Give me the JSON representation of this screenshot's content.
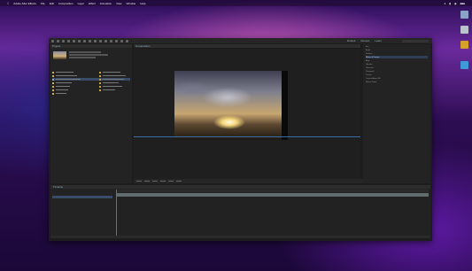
{
  "menubar": {
    "app_menu": "Adobe After Effects",
    "items": [
      "File",
      "Edit",
      "Composition",
      "Layer",
      "Effect",
      "Animation",
      "View",
      "Window",
      "Help"
    ]
  },
  "window": {
    "toolbar": {
      "workspaces": [
        "Default",
        "Review",
        "Learn"
      ],
      "search_placeholder": "Search Help"
    },
    "project_panel": {
      "tab": "Project",
      "items_count": 7
    },
    "composition_panel": {
      "tab": "Composition",
      "zoom": "50%"
    },
    "right_panel": {
      "rows": [
        "Info",
        "Audio",
        "Preview",
        "Effects & Presets",
        "Align",
        "Libraries",
        "Character",
        "Paragraph",
        "Tracker",
        "Content-Aware Fill",
        "Motion Sketch"
      ],
      "highlighted": "Effects & Presets"
    },
    "timeline": {
      "tab": "Timeline",
      "progress": 0.0
    }
  },
  "colors": {
    "accent": "#3a78d8",
    "selection": "#3b4c6b",
    "panel_bg": "#232323"
  }
}
